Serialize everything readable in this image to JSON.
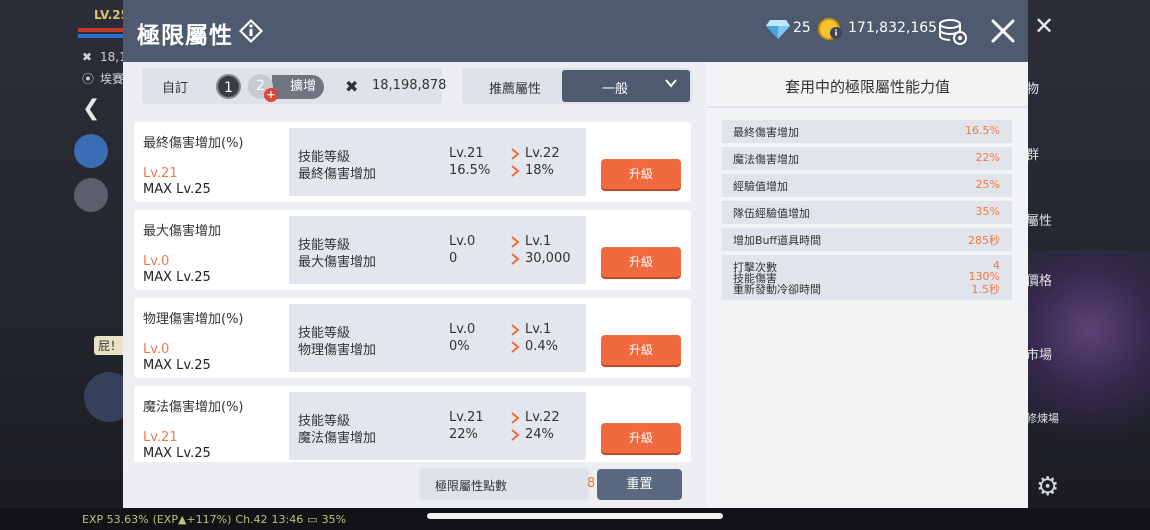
{
  "background": {
    "level": "LV.25",
    "coin_partial": "18,1",
    "location": "埃賽",
    "chat_snippet": "屁！！",
    "right_menu": [
      "物",
      "群",
      "屬性",
      "價格",
      "市場",
      "修煉場"
    ],
    "status_bar": {
      "exp": "EXP 53.63%",
      "exp_bonus": "(EXP▲+117%)",
      "channel": "Ch.42",
      "time": "13:46",
      "battery": "35%"
    }
  },
  "modal": {
    "title": "極限屬性",
    "gems": "25",
    "gold": "171,832,165"
  },
  "toolbar": {
    "custom_label": "自訂",
    "slot1": "1",
    "slot2": "2",
    "expand_label": "擴增",
    "coin_value": "18,198,878",
    "recommend_label": "推薦屬性",
    "dropdown_value": "一般"
  },
  "cards": [
    {
      "name": "最終傷害增加(%)",
      "level": "Lv.21",
      "max": "MAX Lv.25",
      "row1_label": "技能等級",
      "row2_label": "最終傷害增加",
      "cur1": "Lv.21",
      "cur2": "16.5%",
      "next1": "Lv.22",
      "next2": "18%",
      "button": "升級"
    },
    {
      "name": "最大傷害增加",
      "level": "Lv.0",
      "max": "MAX Lv.25",
      "row1_label": "技能等級",
      "row2_label": "最大傷害增加",
      "cur1": "Lv.0",
      "cur2": "0",
      "next1": "Lv.1",
      "next2": "30,000",
      "button": "升級"
    },
    {
      "name": "物理傷害增加(%)",
      "level": "Lv.0",
      "max": "MAX Lv.25",
      "row1_label": "技能等級",
      "row2_label": "物理傷害增加",
      "cur1": "Lv.0",
      "cur2": "0%",
      "next1": "Lv.1",
      "next2": "0.4%",
      "button": "升級"
    },
    {
      "name": "魔法傷害增加(%)",
      "level": "Lv.21",
      "max": "MAX Lv.25",
      "row1_label": "技能等級",
      "row2_label": "魔法傷害增加",
      "cur1": "Lv.21",
      "cur2": "22%",
      "next1": "Lv.22",
      "next2": "24%",
      "button": "升級"
    }
  ],
  "footer": {
    "points_label": "極限屬性點數",
    "points_value": "8",
    "reset_label": "重置"
  },
  "stats_panel": {
    "title": "套用中的極限屬性能力值",
    "rows": [
      {
        "label": "最終傷害增加",
        "value": "16.5%"
      },
      {
        "label": "魔法傷害增加",
        "value": "22%"
      },
      {
        "label": "經驗值增加",
        "value": "25%"
      },
      {
        "label": "隊伍經驗值增加",
        "value": "35%"
      },
      {
        "label": "增加Buff道具時間",
        "value": "285秒"
      }
    ],
    "combo": [
      {
        "label": "打擊次數",
        "value": "4"
      },
      {
        "label": "技能傷害",
        "value": "130%"
      },
      {
        "label": "重新發動冷卻時間",
        "value": "1.5秒"
      }
    ]
  },
  "colors": {
    "header": "#4e5a6e",
    "accent": "#ef6a3e",
    "value_orange": "#ef7b42"
  }
}
